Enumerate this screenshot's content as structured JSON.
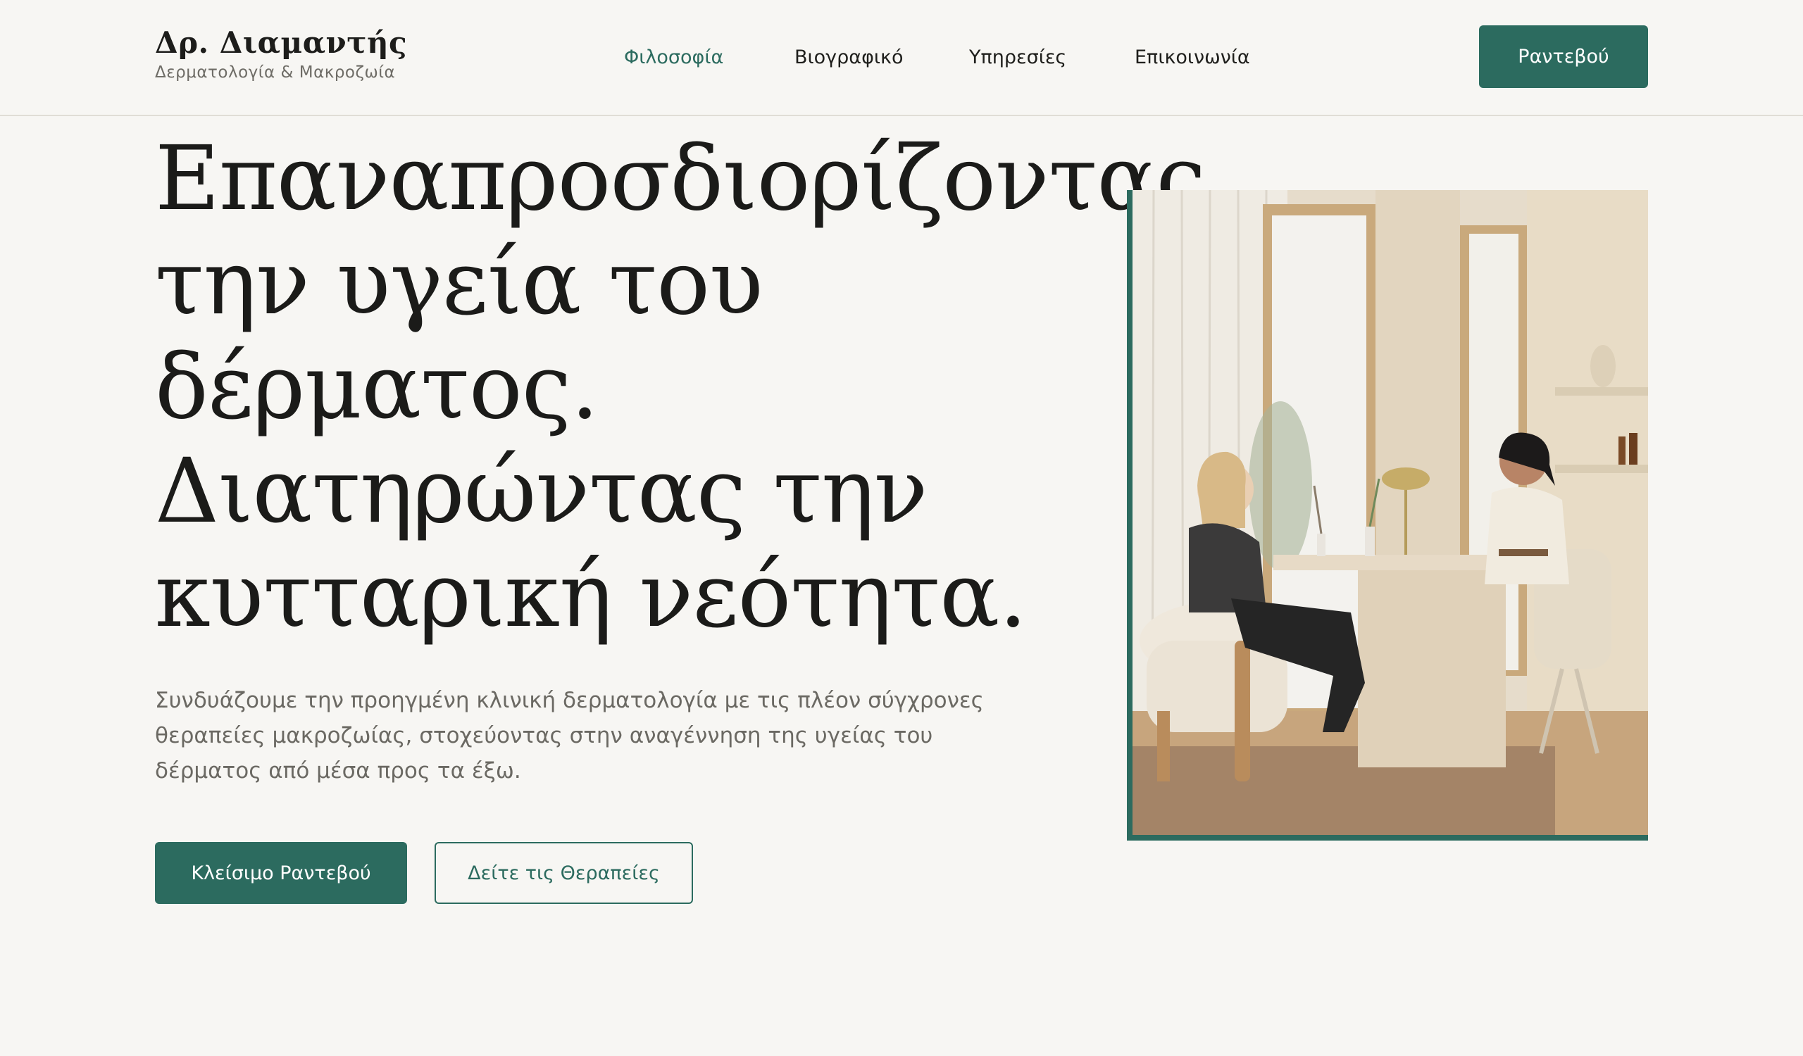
{
  "brand": {
    "name": "Δρ. Διαμαντής",
    "subtitle": "Δερματολογία & Μακροζωία"
  },
  "nav": {
    "items": [
      {
        "label": "Φιλοσοφία",
        "active": true
      },
      {
        "label": "Βιογραφικό",
        "active": false
      },
      {
        "label": "Υπηρεσίες",
        "active": false
      },
      {
        "label": "Επικοινωνία",
        "active": false
      }
    ],
    "cta_label": "Ραντεβού"
  },
  "hero": {
    "title_lines": [
      "Επαναπροσδιορίζοντας",
      "την υγεία του",
      "δέρματος.",
      "Διατηρώντας την",
      "κυτταρική νεότητα."
    ],
    "description": "Συνδυάζουμε την προηγμένη κλινική δερματολογία με τις πλέον σύγχρονες θεραπείες μακροζωίας, στοχεύοντας στην αναγέννηση της υγείας του δέρματος από μέσα προς τα έξω.",
    "primary_button": "Κλείσιμο Ραντεβού",
    "secondary_button": "Δείτε τις Θεραπείες"
  },
  "colors": {
    "accent": "#2c6b5f",
    "background": "#f7f6f3",
    "text": "#1b1b19",
    "muted": "#6b6963"
  }
}
